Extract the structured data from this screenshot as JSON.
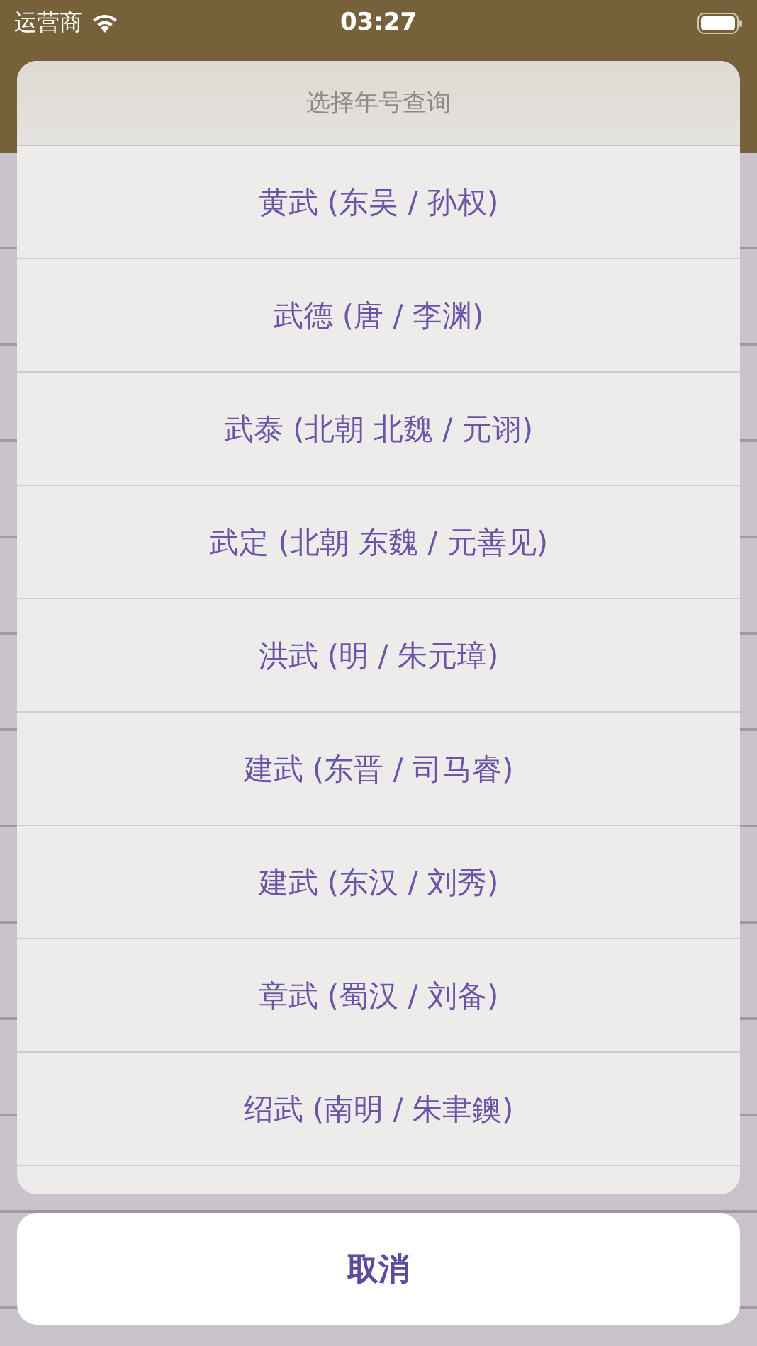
{
  "status_bar": {
    "carrier": "运营商",
    "time": "03:27"
  },
  "action_sheet": {
    "title": "选择年号查询",
    "items": [
      {
        "label": "黄武 (东吴 / 孙权)"
      },
      {
        "label": "武德 (唐 / 李渊)"
      },
      {
        "label": "武泰 (北朝 北魏 / 元诩)"
      },
      {
        "label": "武定 (北朝 东魏 / 元善见)"
      },
      {
        "label": "洪武 (明 / 朱元璋)"
      },
      {
        "label": "建武 (东晋 / 司马睿)"
      },
      {
        "label": "建武 (东汉 / 刘秀)"
      },
      {
        "label": "章武 (蜀汉 / 刘备)"
      },
      {
        "label": "绍武 (南明 / 朱聿鐭)"
      }
    ],
    "cancel": "取消"
  }
}
